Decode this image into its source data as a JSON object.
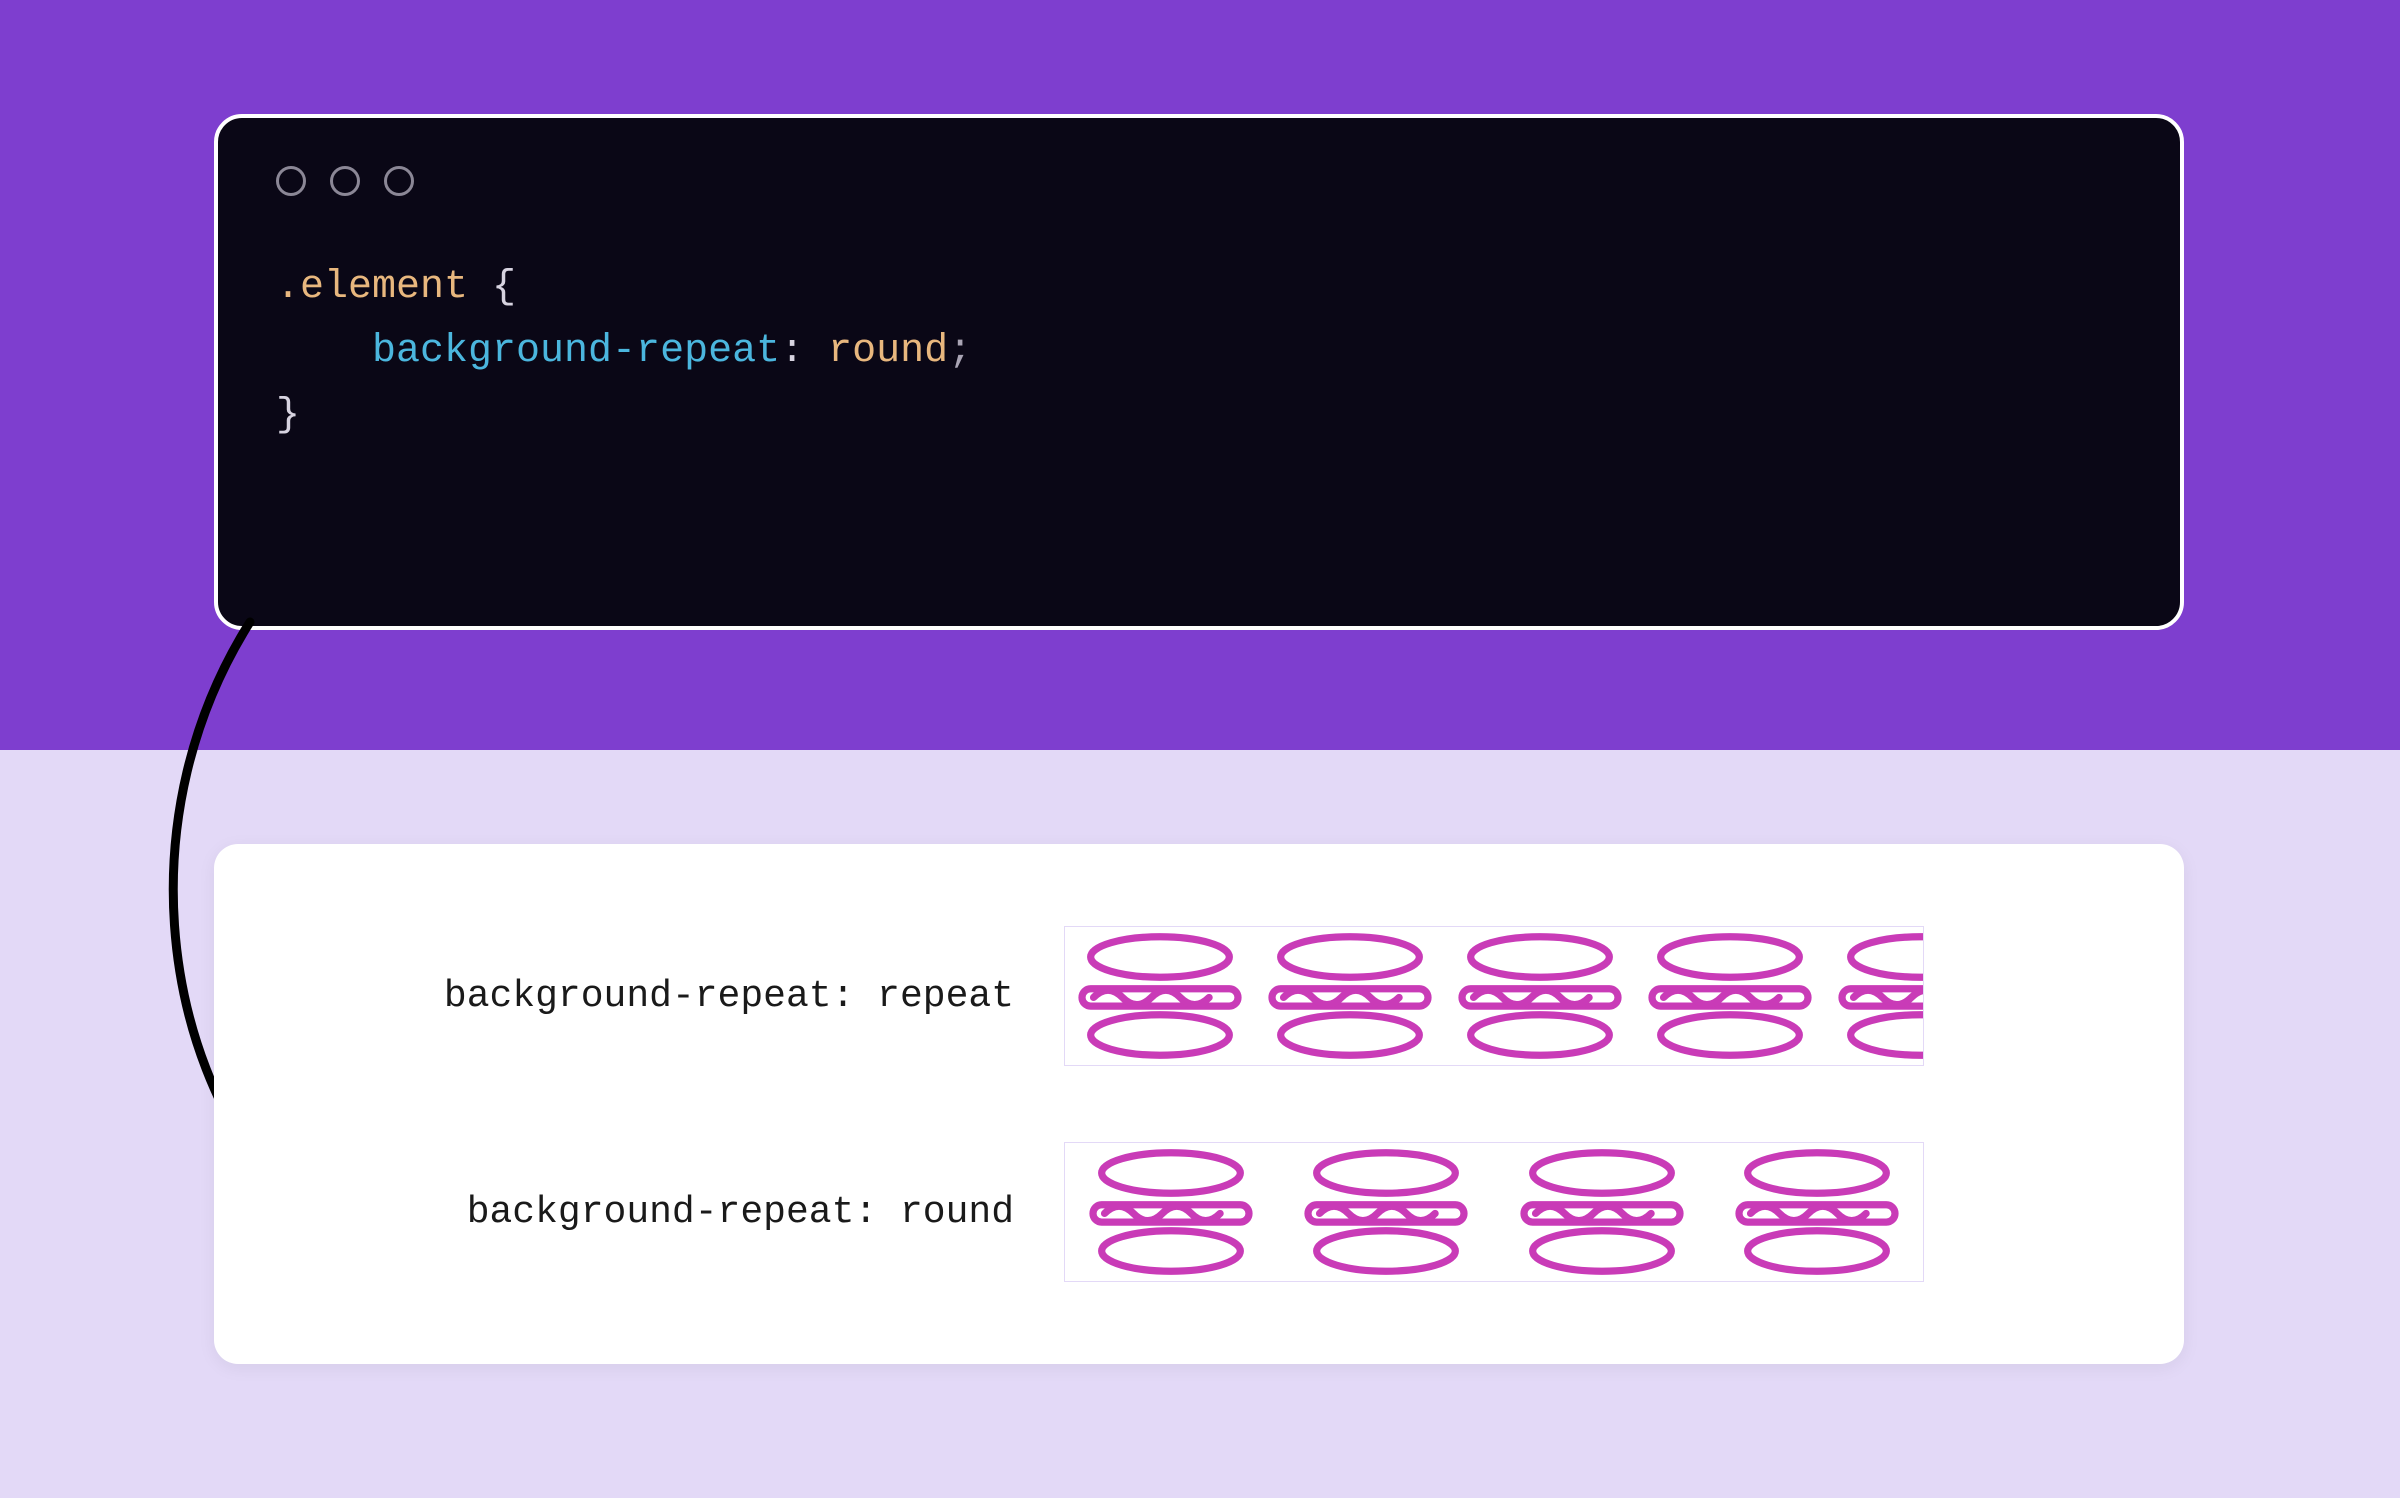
{
  "colors": {
    "bg_band": "#7e3ecf",
    "bg_page": "#e3d9f7",
    "code_bg": "#0a0716",
    "code_border": "#ffffff",
    "dot_ring": "#8b8796",
    "selector": "#e8b77e",
    "property": "#4bb6de",
    "value": "#e8b77e",
    "brace": "#d7d3e0",
    "semi": "#a9a4b4",
    "arrow": "#000000",
    "swatch_border": "#e3d9f7",
    "icon_stroke": "#c93bb7"
  },
  "code": {
    "selector": ".element",
    "brace_open": " {",
    "indent": "    ",
    "property": "background-repeat",
    "colon": ": ",
    "value": "round",
    "semi": ";",
    "brace_close": "}"
  },
  "demo": {
    "rows": [
      {
        "label": "background-repeat: repeat",
        "mode": "repeat",
        "clipped_items": 5
      },
      {
        "label": "background-repeat: round",
        "mode": "round",
        "items": 4
      }
    ],
    "icon_name": "burger-icon"
  }
}
